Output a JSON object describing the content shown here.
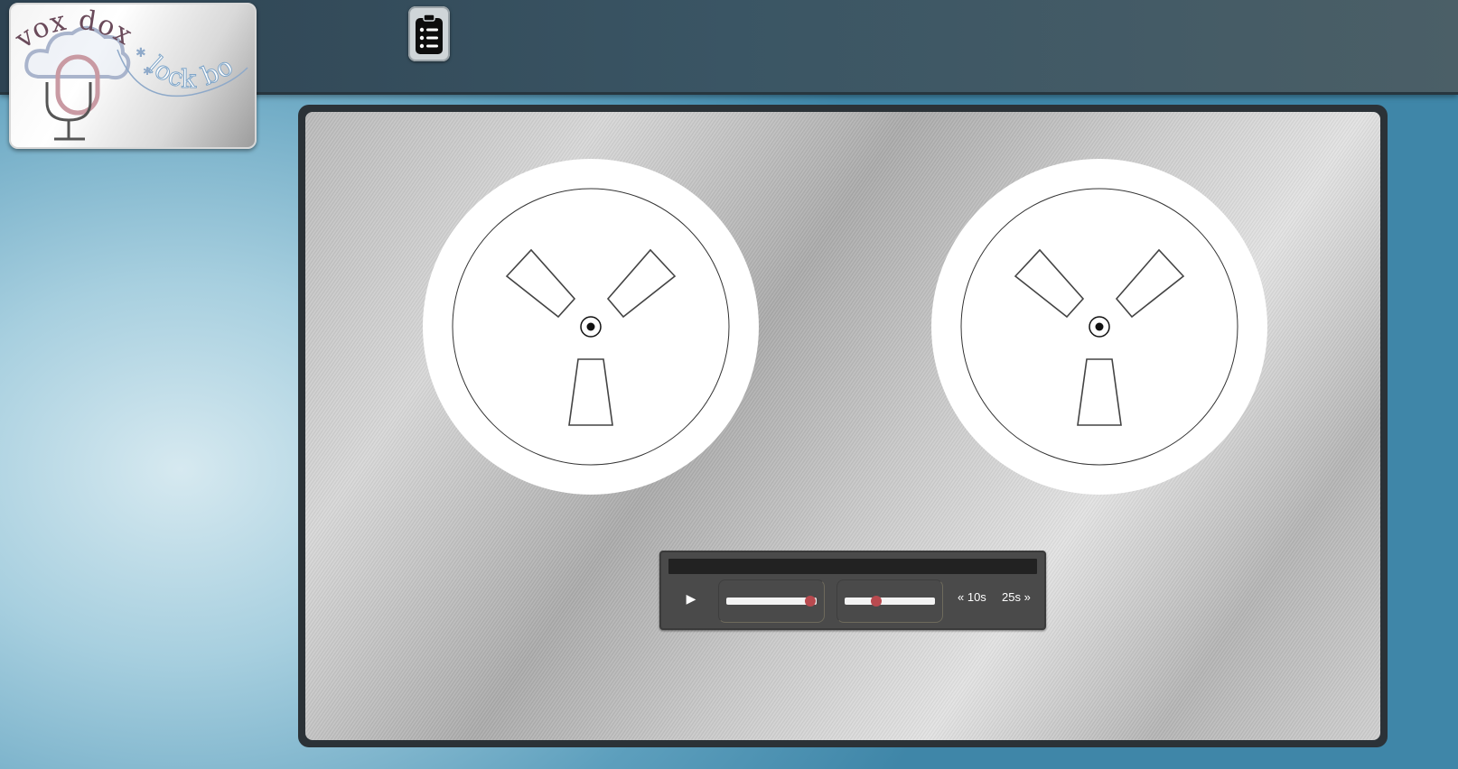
{
  "logo": {
    "line1": "vox dox",
    "line2": "lock box"
  },
  "toolbar": {
    "clipboard_icon": "clipboard-list-icon"
  },
  "player": {
    "play_glyph": "▶",
    "volume_level": 0.93,
    "speed_level": 0.35,
    "back_label": "« 10s",
    "forward_label": "25s »"
  },
  "colors": {
    "topbar": "#3a5564",
    "slider_thumb": "#b84a4f",
    "player_bg": "#4a4a4a",
    "deck_frame": "#2b3237"
  }
}
